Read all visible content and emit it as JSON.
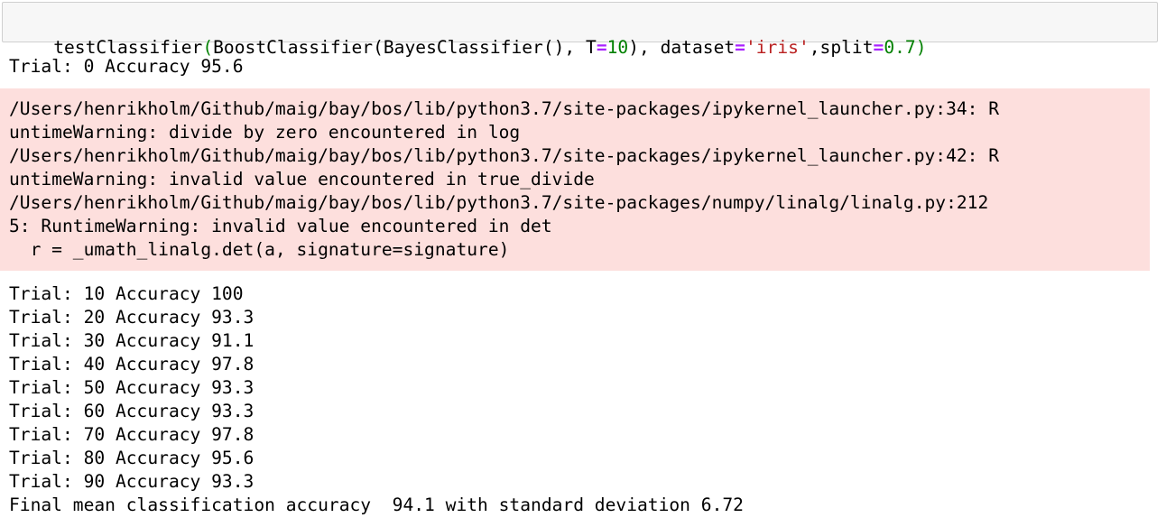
{
  "input": {
    "tokens": [
      {
        "text": "testClassifier",
        "kind": "plain"
      },
      {
        "text": "(",
        "kind": "paren"
      },
      {
        "text": "BoostClassifier(BayesClassifier(), T",
        "kind": "plain"
      },
      {
        "text": "=",
        "kind": "op"
      },
      {
        "text": "10",
        "kind": "num"
      },
      {
        "text": "), dataset",
        "kind": "plain"
      },
      {
        "text": "=",
        "kind": "op"
      },
      {
        "text": "'iris'",
        "kind": "str"
      },
      {
        "text": ",split",
        "kind": "plain"
      },
      {
        "text": "=",
        "kind": "op"
      },
      {
        "text": "0.7",
        "kind": "num"
      },
      {
        "text": ")",
        "kind": "paren"
      }
    ]
  },
  "output": {
    "first_line": "Trial: 0 Accuracy 95.6",
    "stderr_lines": [
      "/Users/henrikholm/Github/maig/bay/bos/lib/python3.7/site-packages/ipykernel_launcher.py:34: R",
      "untimeWarning: divide by zero encountered in log",
      "/Users/henrikholm/Github/maig/bay/bos/lib/python3.7/site-packages/ipykernel_launcher.py:42: R",
      "untimeWarning: invalid value encountered in true_divide",
      "/Users/henrikholm/Github/maig/bay/bos/lib/python3.7/site-packages/numpy/linalg/linalg.py:212",
      "5: RuntimeWarning: invalid value encountered in det",
      "  r = _umath_linalg.det(a, signature=signature)"
    ],
    "trial_lines": [
      "Trial: 10 Accuracy 100",
      "Trial: 20 Accuracy 93.3",
      "Trial: 30 Accuracy 91.1",
      "Trial: 40 Accuracy 97.8",
      "Trial: 50 Accuracy 93.3",
      "Trial: 60 Accuracy 93.3",
      "Trial: 70 Accuracy 97.8",
      "Trial: 80 Accuracy 95.6",
      "Trial: 90 Accuracy 93.3"
    ],
    "final_line": "Final mean classification accuracy  94.1 with standard deviation 6.72"
  },
  "colors": {
    "input_bg": "#f7f7f7",
    "input_border": "#cfcfcf",
    "stderr_bg": "#fddfdd",
    "syntax_paren": "#008000",
    "syntax_operator": "#aa22ff",
    "syntax_number": "#008000",
    "syntax_string": "#ba2121"
  }
}
